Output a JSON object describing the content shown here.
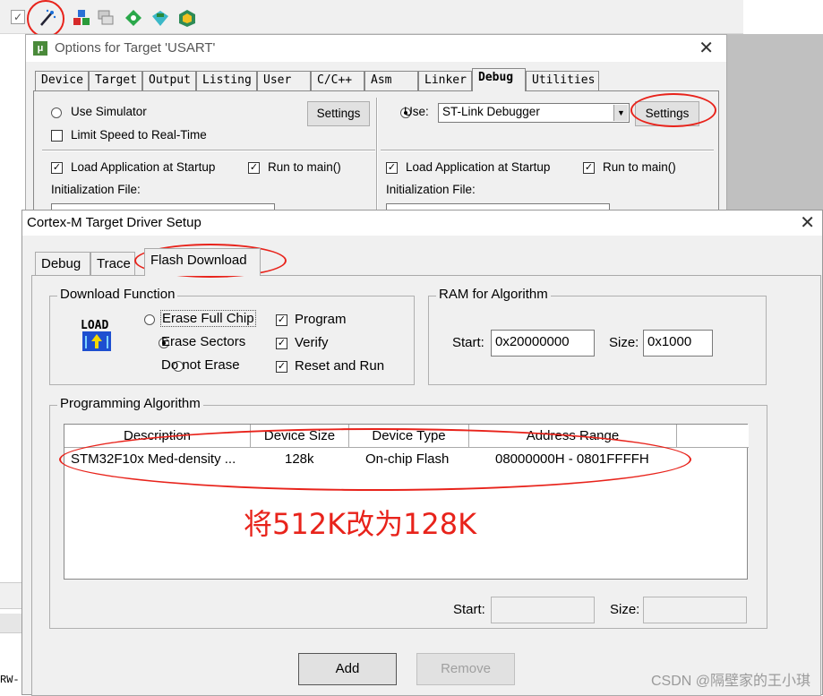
{
  "options_window": {
    "title": "Options for Target 'USART'",
    "tabs": [
      "Device",
      "Target",
      "Output",
      "Listing",
      "User",
      "C/C++",
      "Asm",
      "Linker",
      "Debug",
      "Utilities"
    ],
    "active_tab": "Debug",
    "left": {
      "use_simulator": "Use Simulator",
      "settings": "Settings",
      "limit_speed": "Limit Speed to Real-Time",
      "load_app": "Load Application at Startup",
      "run_to_main": "Run to main()",
      "init_file": "Initialization File:"
    },
    "right": {
      "use": "Use:",
      "debugger": "ST-Link Debugger",
      "settings": "Settings",
      "load_app": "Load Application at Startup",
      "run_to_main": "Run to main()",
      "init_file": "Initialization File:"
    }
  },
  "cortex_dialog": {
    "title": "Cortex-M Target Driver Setup",
    "tabs": [
      "Debug",
      "Trace",
      "Flash Download"
    ],
    "active_tab": "Flash Download",
    "download_function": {
      "title": "Download Function",
      "icon_text": "LOAD",
      "erase_full_chip": "Erase Full Chip",
      "erase_sectors": "Erase Sectors",
      "do_not_erase": "Do not Erase",
      "selected_erase": "Erase Sectors",
      "program": "Program",
      "verify": "Verify",
      "reset_and_run": "Reset and Run"
    },
    "ram_for_algorithm": {
      "title": "RAM for Algorithm",
      "start_label": "Start:",
      "start_value": "0x20000000",
      "size_label": "Size:",
      "size_value": "0x1000"
    },
    "programming_algorithm": {
      "title": "Programming Algorithm",
      "columns": [
        "Description",
        "Device Size",
        "Device Type",
        "Address Range"
      ],
      "rows": [
        [
          "STM32F10x Med-density ...",
          "128k",
          "On-chip Flash",
          "08000000H - 0801FFFFH"
        ]
      ],
      "start_label": "Start:",
      "size_label": "Size:",
      "add": "Add",
      "remove": "Remove"
    }
  },
  "annotation_note": "将512K改为128K",
  "left_edge_text": "RW-",
  "watermark": "CSDN @隔壁家的王小琪",
  "colors": {
    "annotation_red": "#e8231b",
    "window_bg": "#f0f0f0"
  }
}
